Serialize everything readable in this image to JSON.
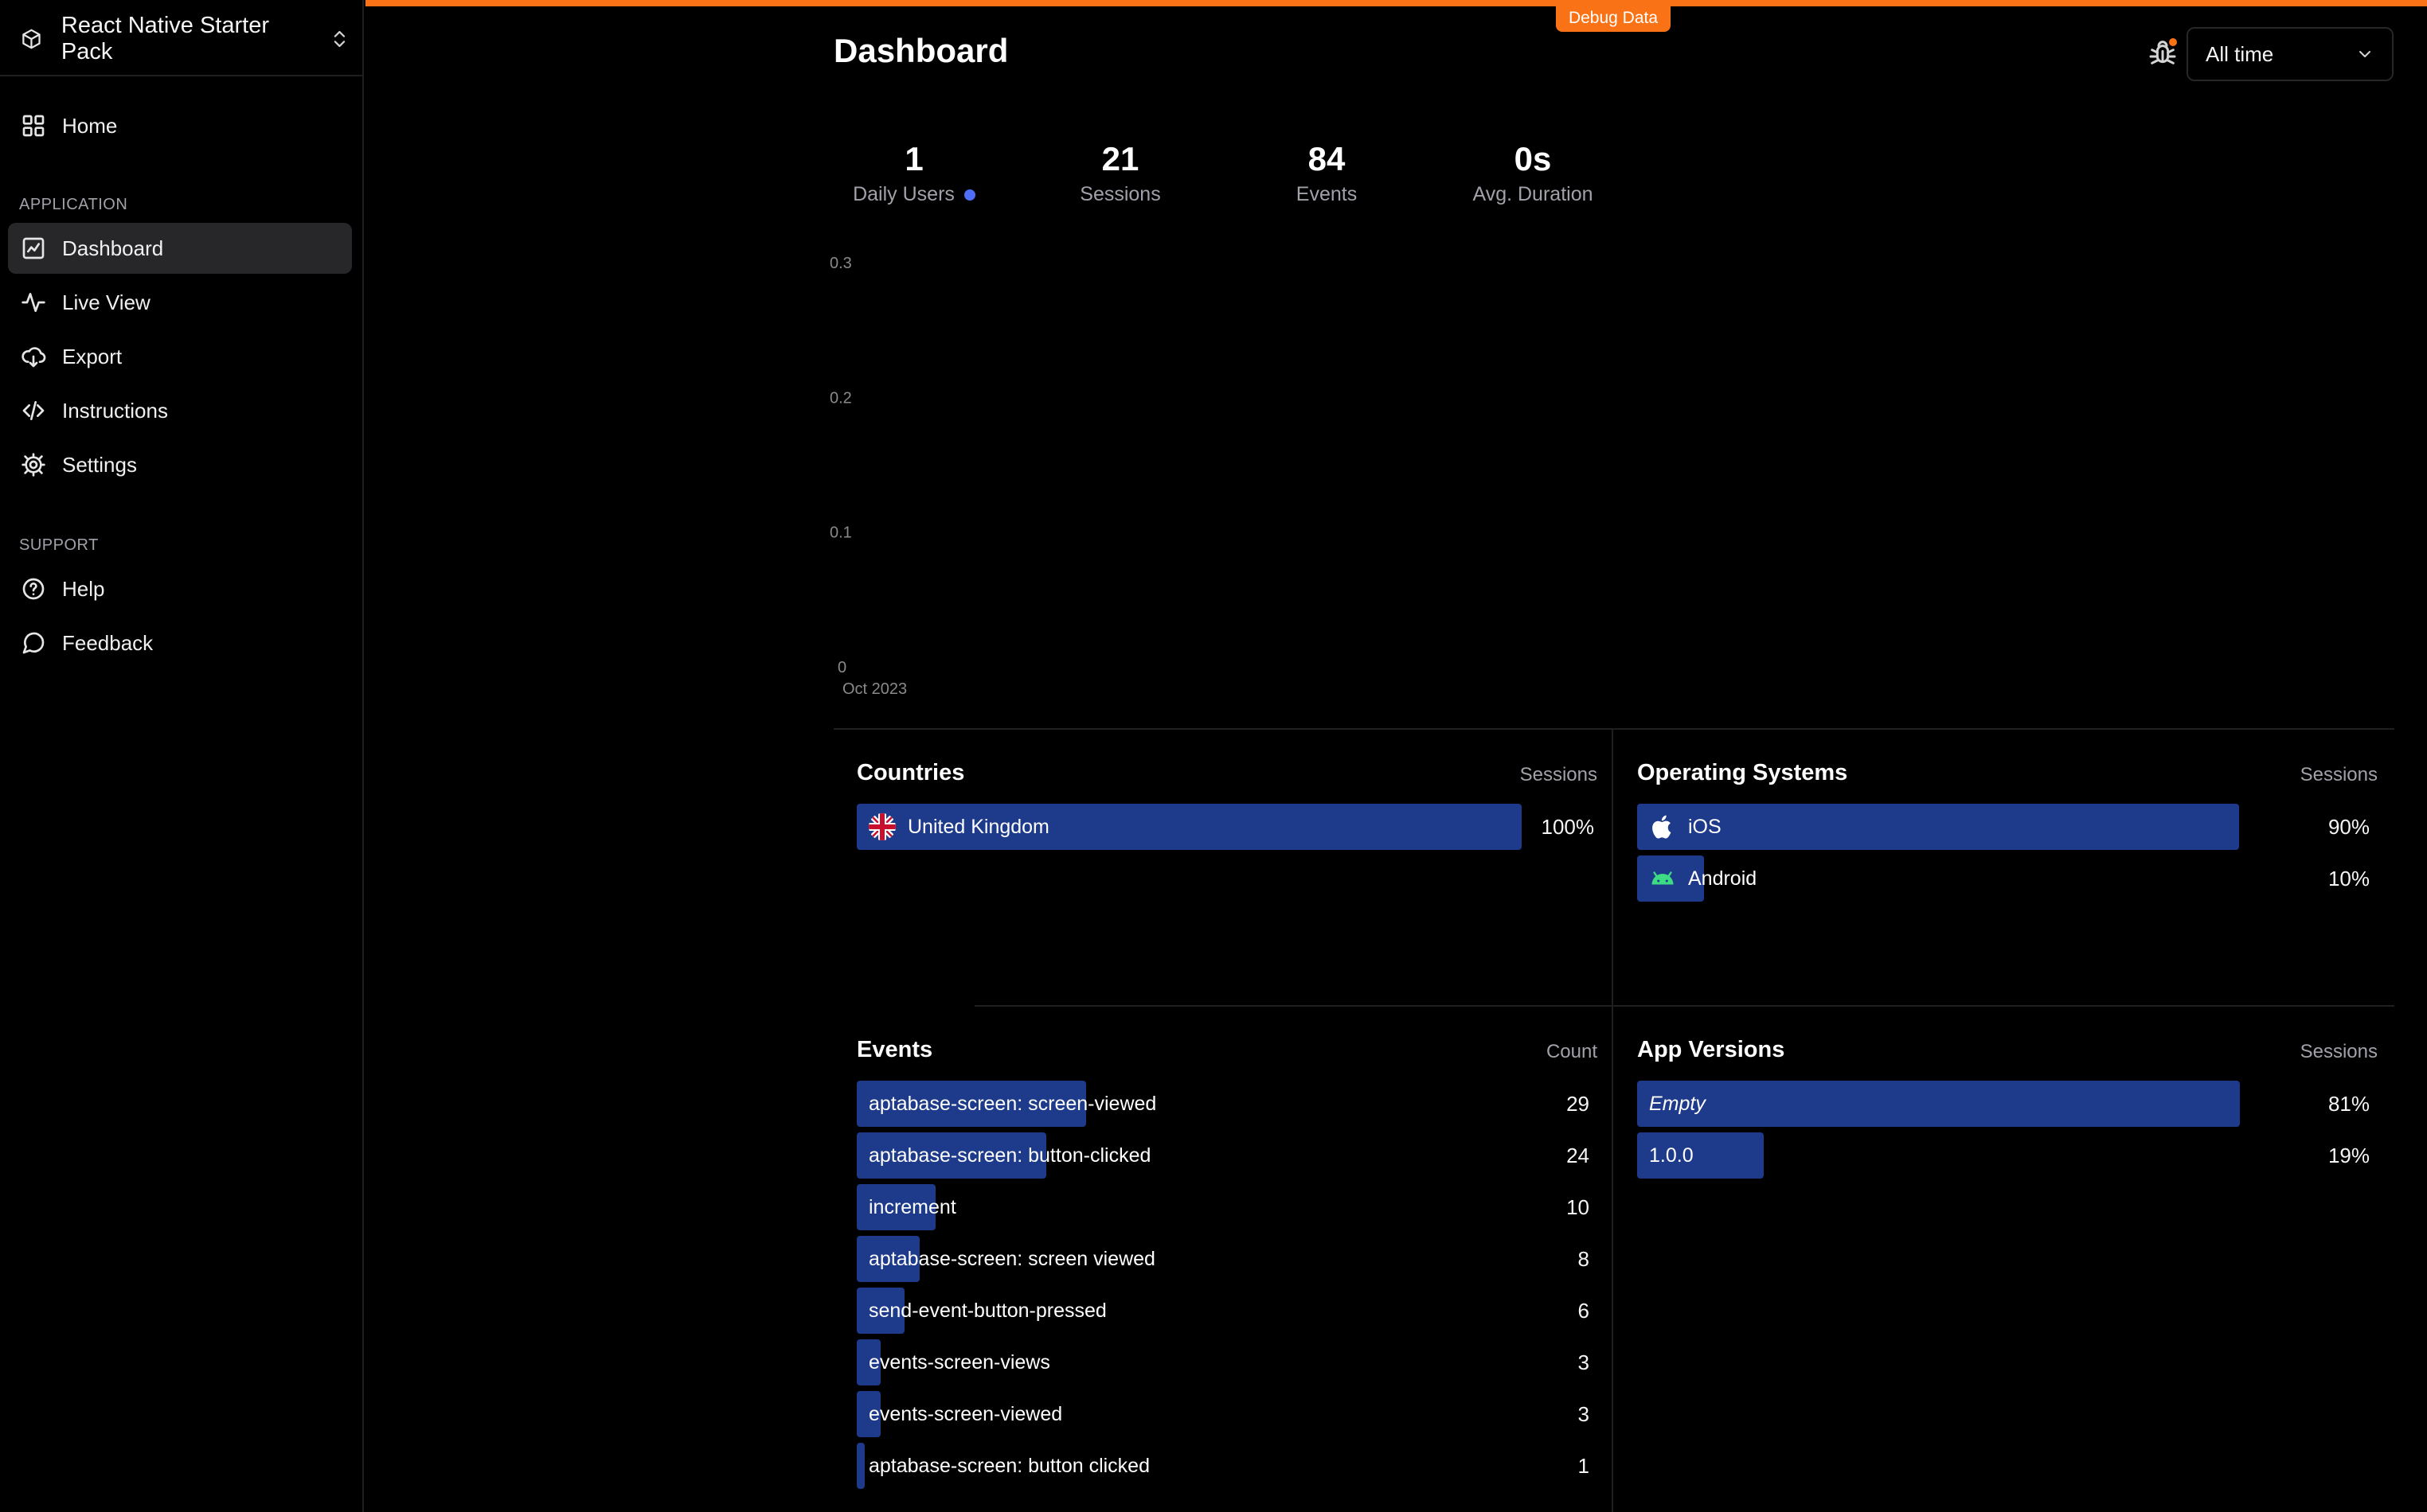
{
  "app": {
    "name": "React Native Starter Pack"
  },
  "sidebar": {
    "home": "Home",
    "sections": [
      {
        "title": "APPLICATION",
        "items": [
          {
            "label": "Dashboard",
            "icon": "chart-line-icon",
            "active": true
          },
          {
            "label": "Live View",
            "icon": "activity-pulse-icon"
          },
          {
            "label": "Export",
            "icon": "cloud-download-icon"
          },
          {
            "label": "Instructions",
            "icon": "code-icon"
          },
          {
            "label": "Settings",
            "icon": "gear-icon"
          }
        ]
      },
      {
        "title": "SUPPORT",
        "items": [
          {
            "label": "Help",
            "icon": "help-circle-icon"
          },
          {
            "label": "Feedback",
            "icon": "message-circle-icon"
          }
        ]
      }
    ]
  },
  "header": {
    "debug_badge": "Debug Data",
    "title": "Dashboard",
    "period": "All time"
  },
  "stats": [
    {
      "value": "1",
      "label": "Daily Users"
    },
    {
      "value": "21",
      "label": "Sessions"
    },
    {
      "value": "84",
      "label": "Events"
    },
    {
      "value": "0s",
      "label": "Avg. Duration"
    }
  ],
  "chart_data": {
    "type": "line",
    "x": [
      "Oct 2023"
    ],
    "series": [],
    "yticks": [
      "0.3",
      "0.2",
      "0.1",
      "0"
    ],
    "ylim": [
      0,
      0.3
    ]
  },
  "countries": {
    "title": "Countries",
    "metric": "Sessions",
    "rows": [
      {
        "name": "United Kingdom",
        "value": "100%",
        "fraction": 1.0
      }
    ]
  },
  "operating_systems": {
    "title": "Operating Systems",
    "metric": "Sessions",
    "rows": [
      {
        "name": "iOS",
        "value": "90%",
        "fraction": 0.9
      },
      {
        "name": "Android",
        "value": "10%",
        "fraction": 0.1
      }
    ]
  },
  "events": {
    "title": "Events",
    "metric": "Count",
    "rows": [
      {
        "name": "aptabase-screen: screen-viewed",
        "value": "29",
        "fraction": 1.0
      },
      {
        "name": "aptabase-screen: button-clicked",
        "value": "24",
        "fraction": 0.828
      },
      {
        "name": "increment",
        "value": "10",
        "fraction": 0.345
      },
      {
        "name": "aptabase-screen: screen viewed",
        "value": "8",
        "fraction": 0.276
      },
      {
        "name": "send-event-button-pressed",
        "value": "6",
        "fraction": 0.207
      },
      {
        "name": "events-screen-views",
        "value": "3",
        "fraction": 0.103
      },
      {
        "name": "events-screen-viewed",
        "value": "3",
        "fraction": 0.103
      },
      {
        "name": "aptabase-screen: button clicked",
        "value": "1",
        "fraction": 0.034
      }
    ]
  },
  "app_versions": {
    "title": "App Versions",
    "metric": "Sessions",
    "rows": [
      {
        "name": "Empty",
        "value": "81%",
        "fraction": 0.81
      },
      {
        "name": "1.0.0",
        "value": "19%",
        "fraction": 0.19
      }
    ]
  },
  "colors": {
    "accent": "#f97316",
    "bar": "#1e3a8a",
    "dot": "#4f6ef7"
  }
}
